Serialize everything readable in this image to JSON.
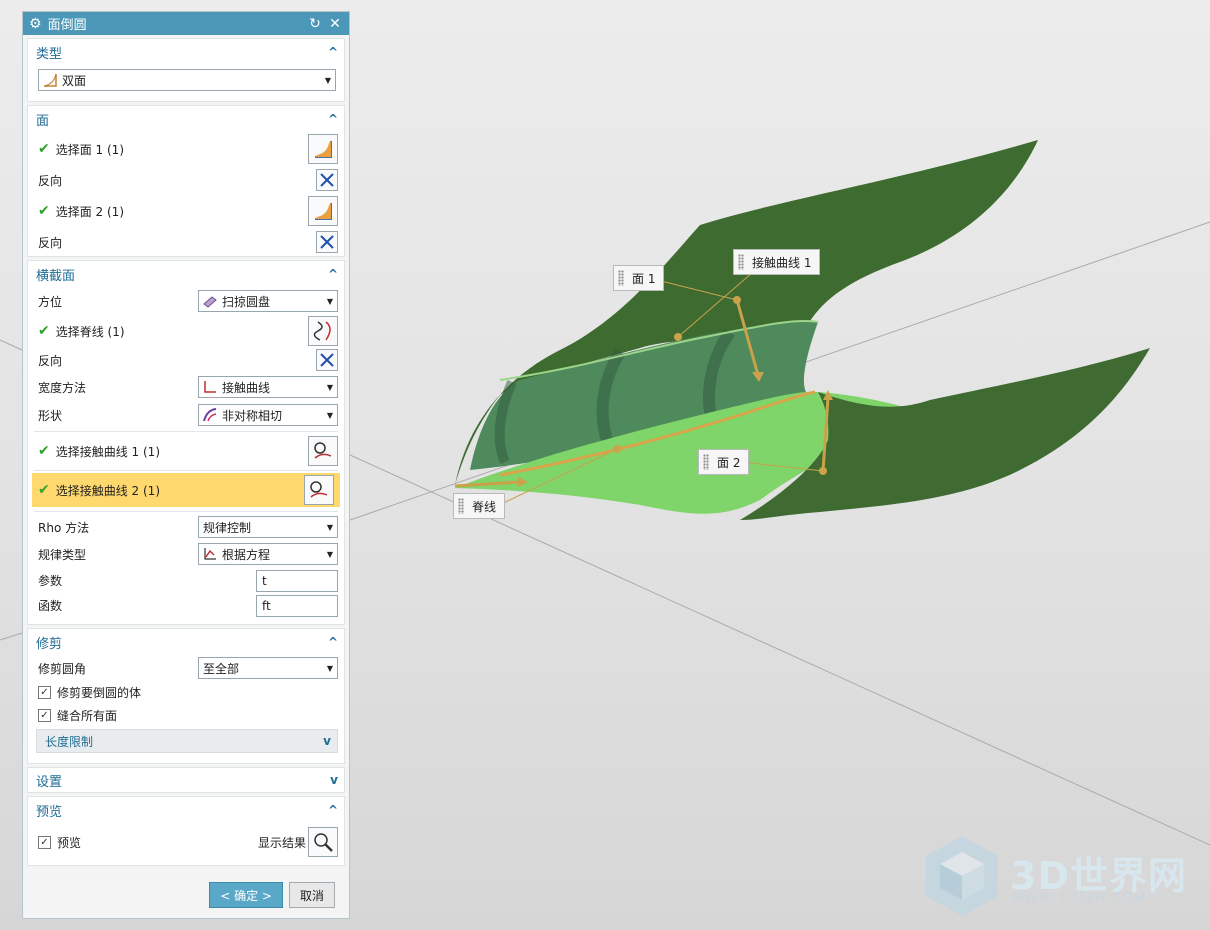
{
  "dialog": {
    "title": "面倒圆",
    "type_section": {
      "header": "类型",
      "selected": "双面"
    },
    "face_section": {
      "header": "面",
      "select_face1": "选择面 1 (1)",
      "reverse1": "反向",
      "select_face2": "选择面 2 (1)",
      "reverse2": "反向"
    },
    "cross_section": {
      "header": "横截面",
      "orientation_label": "方位",
      "orientation_value": "扫掠圆盘",
      "select_spine": "选择脊线 (1)",
      "reverse": "反向",
      "width_method_label": "宽度方法",
      "width_method_value": "接触曲线",
      "shape_label": "形状",
      "shape_value": "非对称相切",
      "contact_curve1": "选择接触曲线 1 (1)",
      "contact_curve2": "选择接触曲线 2 (1)",
      "rho_method_label": "Rho 方法",
      "rho_method_value": "规律控制",
      "law_type_label": "规律类型",
      "law_type_value": "根据方程",
      "param_label": "参数",
      "param_value": "t",
      "func_label": "函数",
      "func_value": "ft"
    },
    "trim_section": {
      "header": "修剪",
      "trim_fillet_label": "修剪圆角",
      "trim_fillet_value": "至全部",
      "trim_body_label": "修剪要倒圆的体",
      "trim_body_checked": true,
      "sew_label": "缝合所有面",
      "sew_checked": true,
      "length_limit": "长度限制"
    },
    "settings_section": {
      "header": "设置"
    },
    "preview_section": {
      "header": "预览",
      "preview_label": "预览",
      "preview_checked": true,
      "show_result": "显示结果"
    },
    "ok_label": "< 确定 >",
    "cancel_label": "取消"
  },
  "viewport": {
    "labels": {
      "face1": "面 1",
      "contact_curve1": "接触曲线 1",
      "face2": "面 2",
      "spine": "脊线"
    },
    "watermark": {
      "main": "3D世界网",
      "sub": "WWW.3DSJW.COM"
    }
  },
  "colors": {
    "title_bar": "#4b97b8",
    "section_header": "#1f6c94",
    "highlight": "#ffd86e",
    "dark_green": "#3f6b32",
    "light_green": "#7fd46a",
    "handle": "#c9a24a"
  }
}
